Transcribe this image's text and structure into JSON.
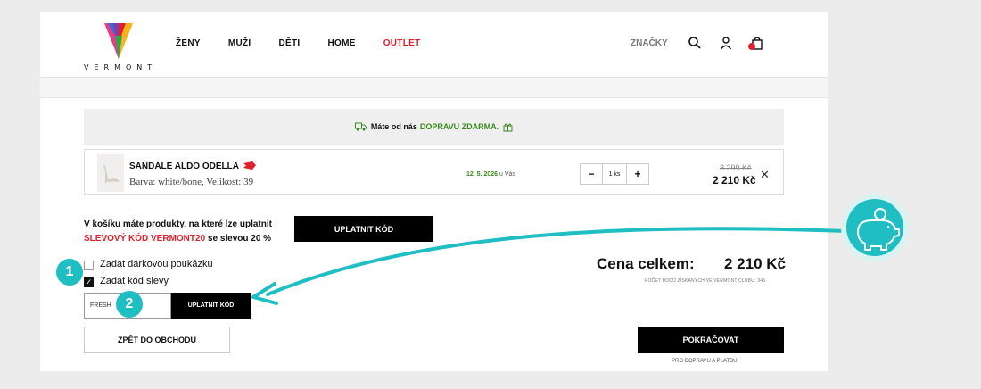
{
  "header": {
    "logo_text": "VERMONT",
    "nav": [
      "ŽENY",
      "MUŽI",
      "DĚTI",
      "HOME"
    ],
    "outlet": "OUTLET",
    "brands": "ZNAČKY",
    "badge_color": "#e0202a"
  },
  "shipping": {
    "prefix": "Máte od nás",
    "highlight": "DOPRAVU ZDARMA."
  },
  "item": {
    "name": "SANDÁLE ALDO ODELLA",
    "attributes": "Barva: white/bone, Velikost: 39",
    "delivery_date": "12. 5. 2026",
    "delivery_suffix": "u Vás",
    "qty_minus": "−",
    "qty_value": "1 ks",
    "qty_plus": "+",
    "old_price": "3 299 Kč",
    "price": "2 210 Kč",
    "remove": "✕"
  },
  "promo": {
    "line1": "V košíku máte produkty, na které lze uplatnit",
    "code_label": "SLEVOVÝ KÓD VERMONT20",
    "line2_suffix": "se slevou 20 %",
    "apply_label": "UPLATNIT KÓD"
  },
  "options": {
    "gift_voucher": "Zadat dárkovou poukázku",
    "discount_code": "Zadat kód slevy",
    "discount_checked": true
  },
  "code_field": {
    "value": "FRESH",
    "apply_label": "UPLATNIT KÓD"
  },
  "back_label": "ZPĚT DO OBCHODU",
  "summary": {
    "total_label": "Cena celkem:",
    "total_value": "2 210 Kč",
    "points_note": "POČET BODŮ ZÍSKANÝCH VE VERMONT CLUBU: 345",
    "continue_label": "POKRAČOVAT",
    "continue_note": "PRO DOPRAVU A PLATBU"
  },
  "annotations": {
    "step1": "1",
    "step2": "2",
    "accent_color": "#1fbec2"
  }
}
